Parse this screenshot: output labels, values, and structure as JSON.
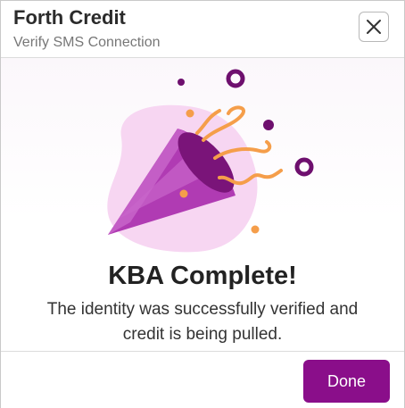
{
  "header": {
    "title": "Forth Credit",
    "subtitle": "Verify SMS Connection",
    "close_icon": "close-icon"
  },
  "main": {
    "illustration_icon": "party-popper-icon",
    "heading": "KBA Complete!",
    "message_line_1": "The identity was successfully verified and",
    "message_line_2": "credit is being pulled."
  },
  "footer": {
    "done_label": "Done"
  },
  "colors": {
    "accent": "#8a0e8a",
    "confetti_orange": "#f59e4a",
    "confetti_purple": "#6e0f6e",
    "blob_pink": "#f7d6f2"
  }
}
